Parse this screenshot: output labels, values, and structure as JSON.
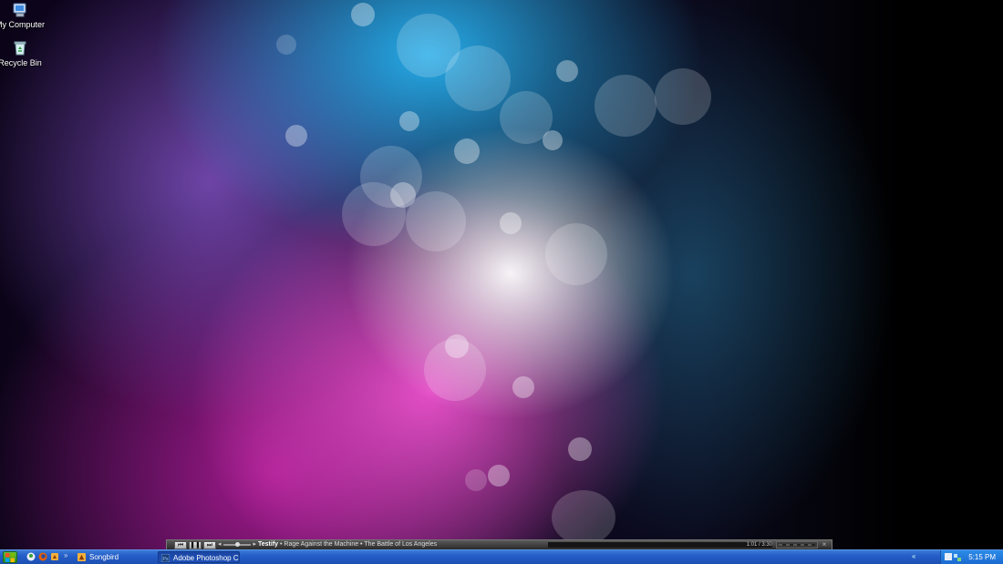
{
  "desktop": {
    "icons": [
      {
        "label": "My Computer",
        "icon": "my-computer-icon"
      },
      {
        "label": "Recycle Bin",
        "icon": "recycle-bin-icon"
      }
    ]
  },
  "player": {
    "track_title": "Testify",
    "track_rest": " • Rage Against the Machine • The Battle of Los Angeles",
    "elapsed": "1:01",
    "time_sep": " / ",
    "duration": "3:30",
    "progress": 0.0,
    "volume": 0.5,
    "buttons": {
      "prev": "⏮",
      "pause": "❚❚",
      "next": "⏭"
    },
    "close": "×"
  },
  "taskbar": {
    "quick_launch_more": "»",
    "tasks": [
      {
        "label": "Songbird",
        "active": false
      },
      {
        "label": "Adobe Photoshop C...",
        "active": true
      }
    ],
    "tray_expand": "«",
    "clock": "5:15 PM"
  },
  "colors": {
    "taskbar": "#245ec9",
    "start": "#2e8e24",
    "tray": "#1b6bd1"
  }
}
